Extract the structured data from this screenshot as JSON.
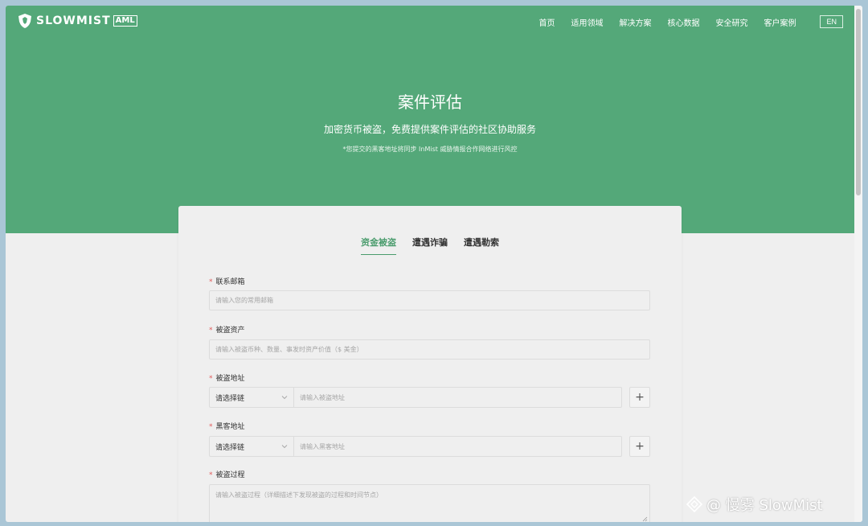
{
  "header": {
    "brand": "SLOWMIST",
    "brand_badge": "AML",
    "nav": [
      "首页",
      "适用领域",
      "解决方案",
      "核心数据",
      "安全研究",
      "客户案例"
    ],
    "lang": "EN"
  },
  "hero": {
    "title": "案件评估",
    "subtitle": "加密货币被盗，免费提供案件评估的社区协助服务",
    "note": "*您提交的黑客地址将同步 InMist 威胁情报合作网络进行风控"
  },
  "tabs": [
    {
      "label": "资金被盗",
      "active": true
    },
    {
      "label": "遭遇诈骗",
      "active": false
    },
    {
      "label": "遭遇勒索",
      "active": false
    }
  ],
  "form": {
    "required_mark": "*",
    "email": {
      "label": "联系邮箱",
      "placeholder": "请输入您的常用邮箱"
    },
    "assets": {
      "label": "被盗资产",
      "placeholder": "请输入被盗币种、数量、事发时资产价值（$ 美金）"
    },
    "stolen_address": {
      "label": "被盗地址",
      "chain_select": "请选择链",
      "placeholder": "请输入被盗地址",
      "add": "+"
    },
    "hacker_address": {
      "label": "黑客地址",
      "chain_select": "请选择链",
      "placeholder": "请输入黑客地址",
      "add": "+"
    },
    "process": {
      "label": "被盗过程",
      "placeholder": "请输入被盗过程（详细描述下发现被盗的过程和时间节点）"
    }
  },
  "watermark": "@ 慢雾 SlowMist",
  "colors": {
    "accent": "#54a879",
    "tab_active": "#4a9c6d",
    "required": "#e05a5a"
  }
}
